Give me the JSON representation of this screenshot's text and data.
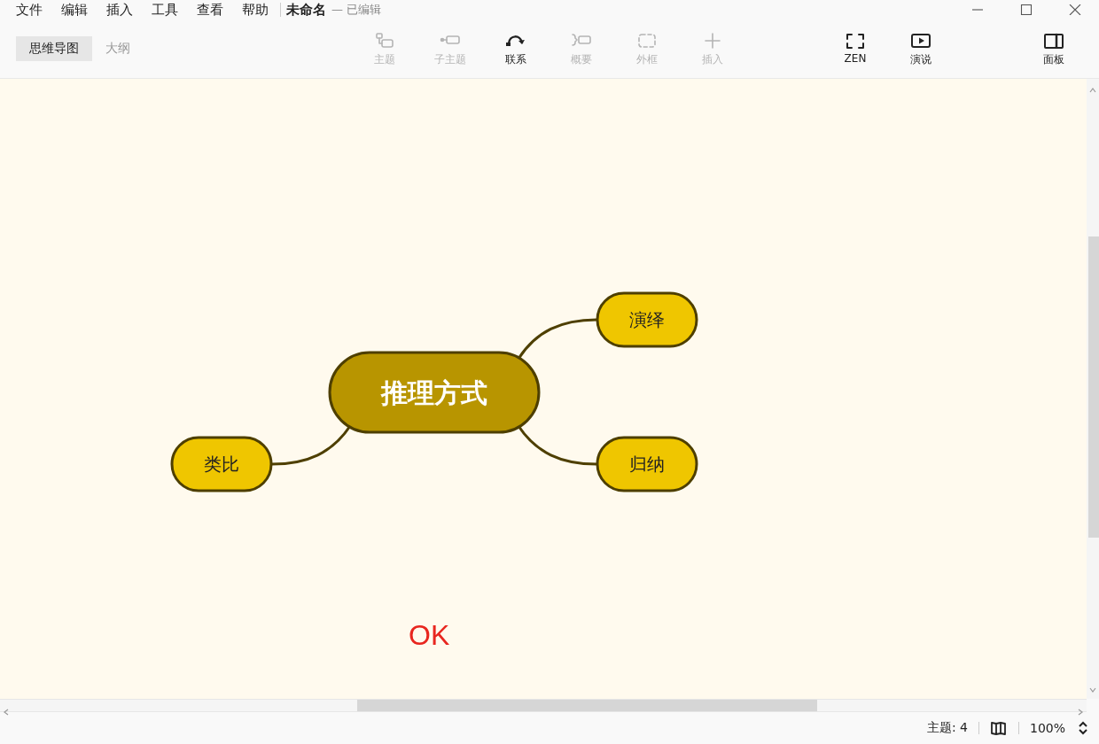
{
  "menu": [
    "文件",
    "编辑",
    "插入",
    "工具",
    "查看",
    "帮助"
  ],
  "document": {
    "title": "未命名",
    "status": "— 已编辑"
  },
  "view_tabs": [
    {
      "label": "思维导图",
      "selected": true
    },
    {
      "label": "大纲",
      "selected": false
    }
  ],
  "toolbar": [
    {
      "label": "主题",
      "kind": "topic",
      "disabled": true
    },
    {
      "label": "子主题",
      "kind": "subtopic",
      "disabled": true
    },
    {
      "label": "联系",
      "kind": "relationship",
      "disabled": false
    },
    {
      "label": "概要",
      "kind": "summary",
      "disabled": true
    },
    {
      "label": "外框",
      "kind": "boundary",
      "disabled": true
    },
    {
      "label": "插入",
      "kind": "insert",
      "disabled": true
    }
  ],
  "view_tools": [
    {
      "label": "ZEN",
      "kind": "zen"
    },
    {
      "label": "演说",
      "kind": "play"
    }
  ],
  "panel_button": {
    "label": "面板",
    "kind": "panel"
  },
  "mind_map": {
    "central": "推理方式",
    "topics": [
      {
        "label": "演绎"
      },
      {
        "label": "归纳"
      },
      {
        "label": "类比"
      }
    ],
    "note": "OK"
  },
  "status_bar": {
    "topic_count": "主题: 4",
    "zoom": "100%"
  }
}
